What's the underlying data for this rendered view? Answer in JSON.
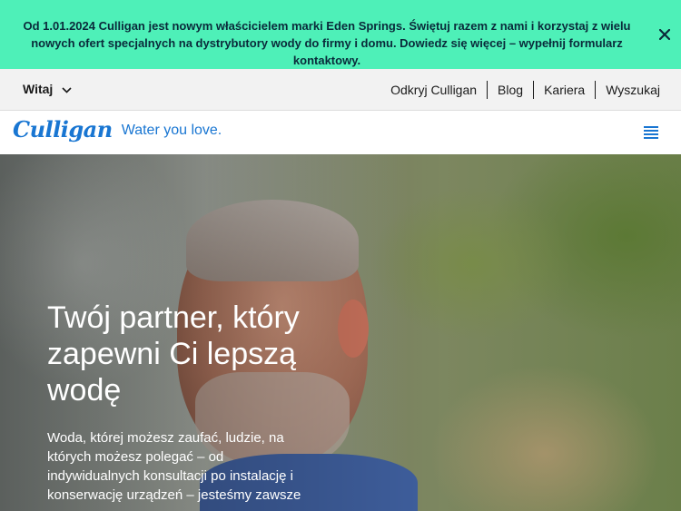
{
  "announcement": {
    "text": "Od 1.01.2024 Culligan jest nowym właścicielem marki Eden Springs. Świętuj razem z nami i korzystaj z wielu nowych ofert specjalnych na dystrybutory wody do firmy i domu. Dowiedz się więcej – wypełnij formularz kontaktowy.",
    "close_icon": "close-icon",
    "background": "#4ef0b8"
  },
  "utility_bar": {
    "language_label": "Witaj",
    "language_icon": "chevron-down-icon",
    "links": [
      "Odkryj Culligan",
      "Blog",
      "Kariera",
      "Wyszukaj"
    ]
  },
  "main_nav": {
    "logo_text": "Culligan",
    "tagline": "Water you love.",
    "menu_icon": "hamburger-menu-icon",
    "accent": "#1976d2"
  },
  "hero": {
    "title": "Twój partner, który zapewni Ci lepszą wodę",
    "text": "Woda, której możesz zaufać, ludzie, na których możesz polegać – od indywidualnych konsultacji po instalację i konserwację urządzeń – jesteśmy zawsze"
  }
}
